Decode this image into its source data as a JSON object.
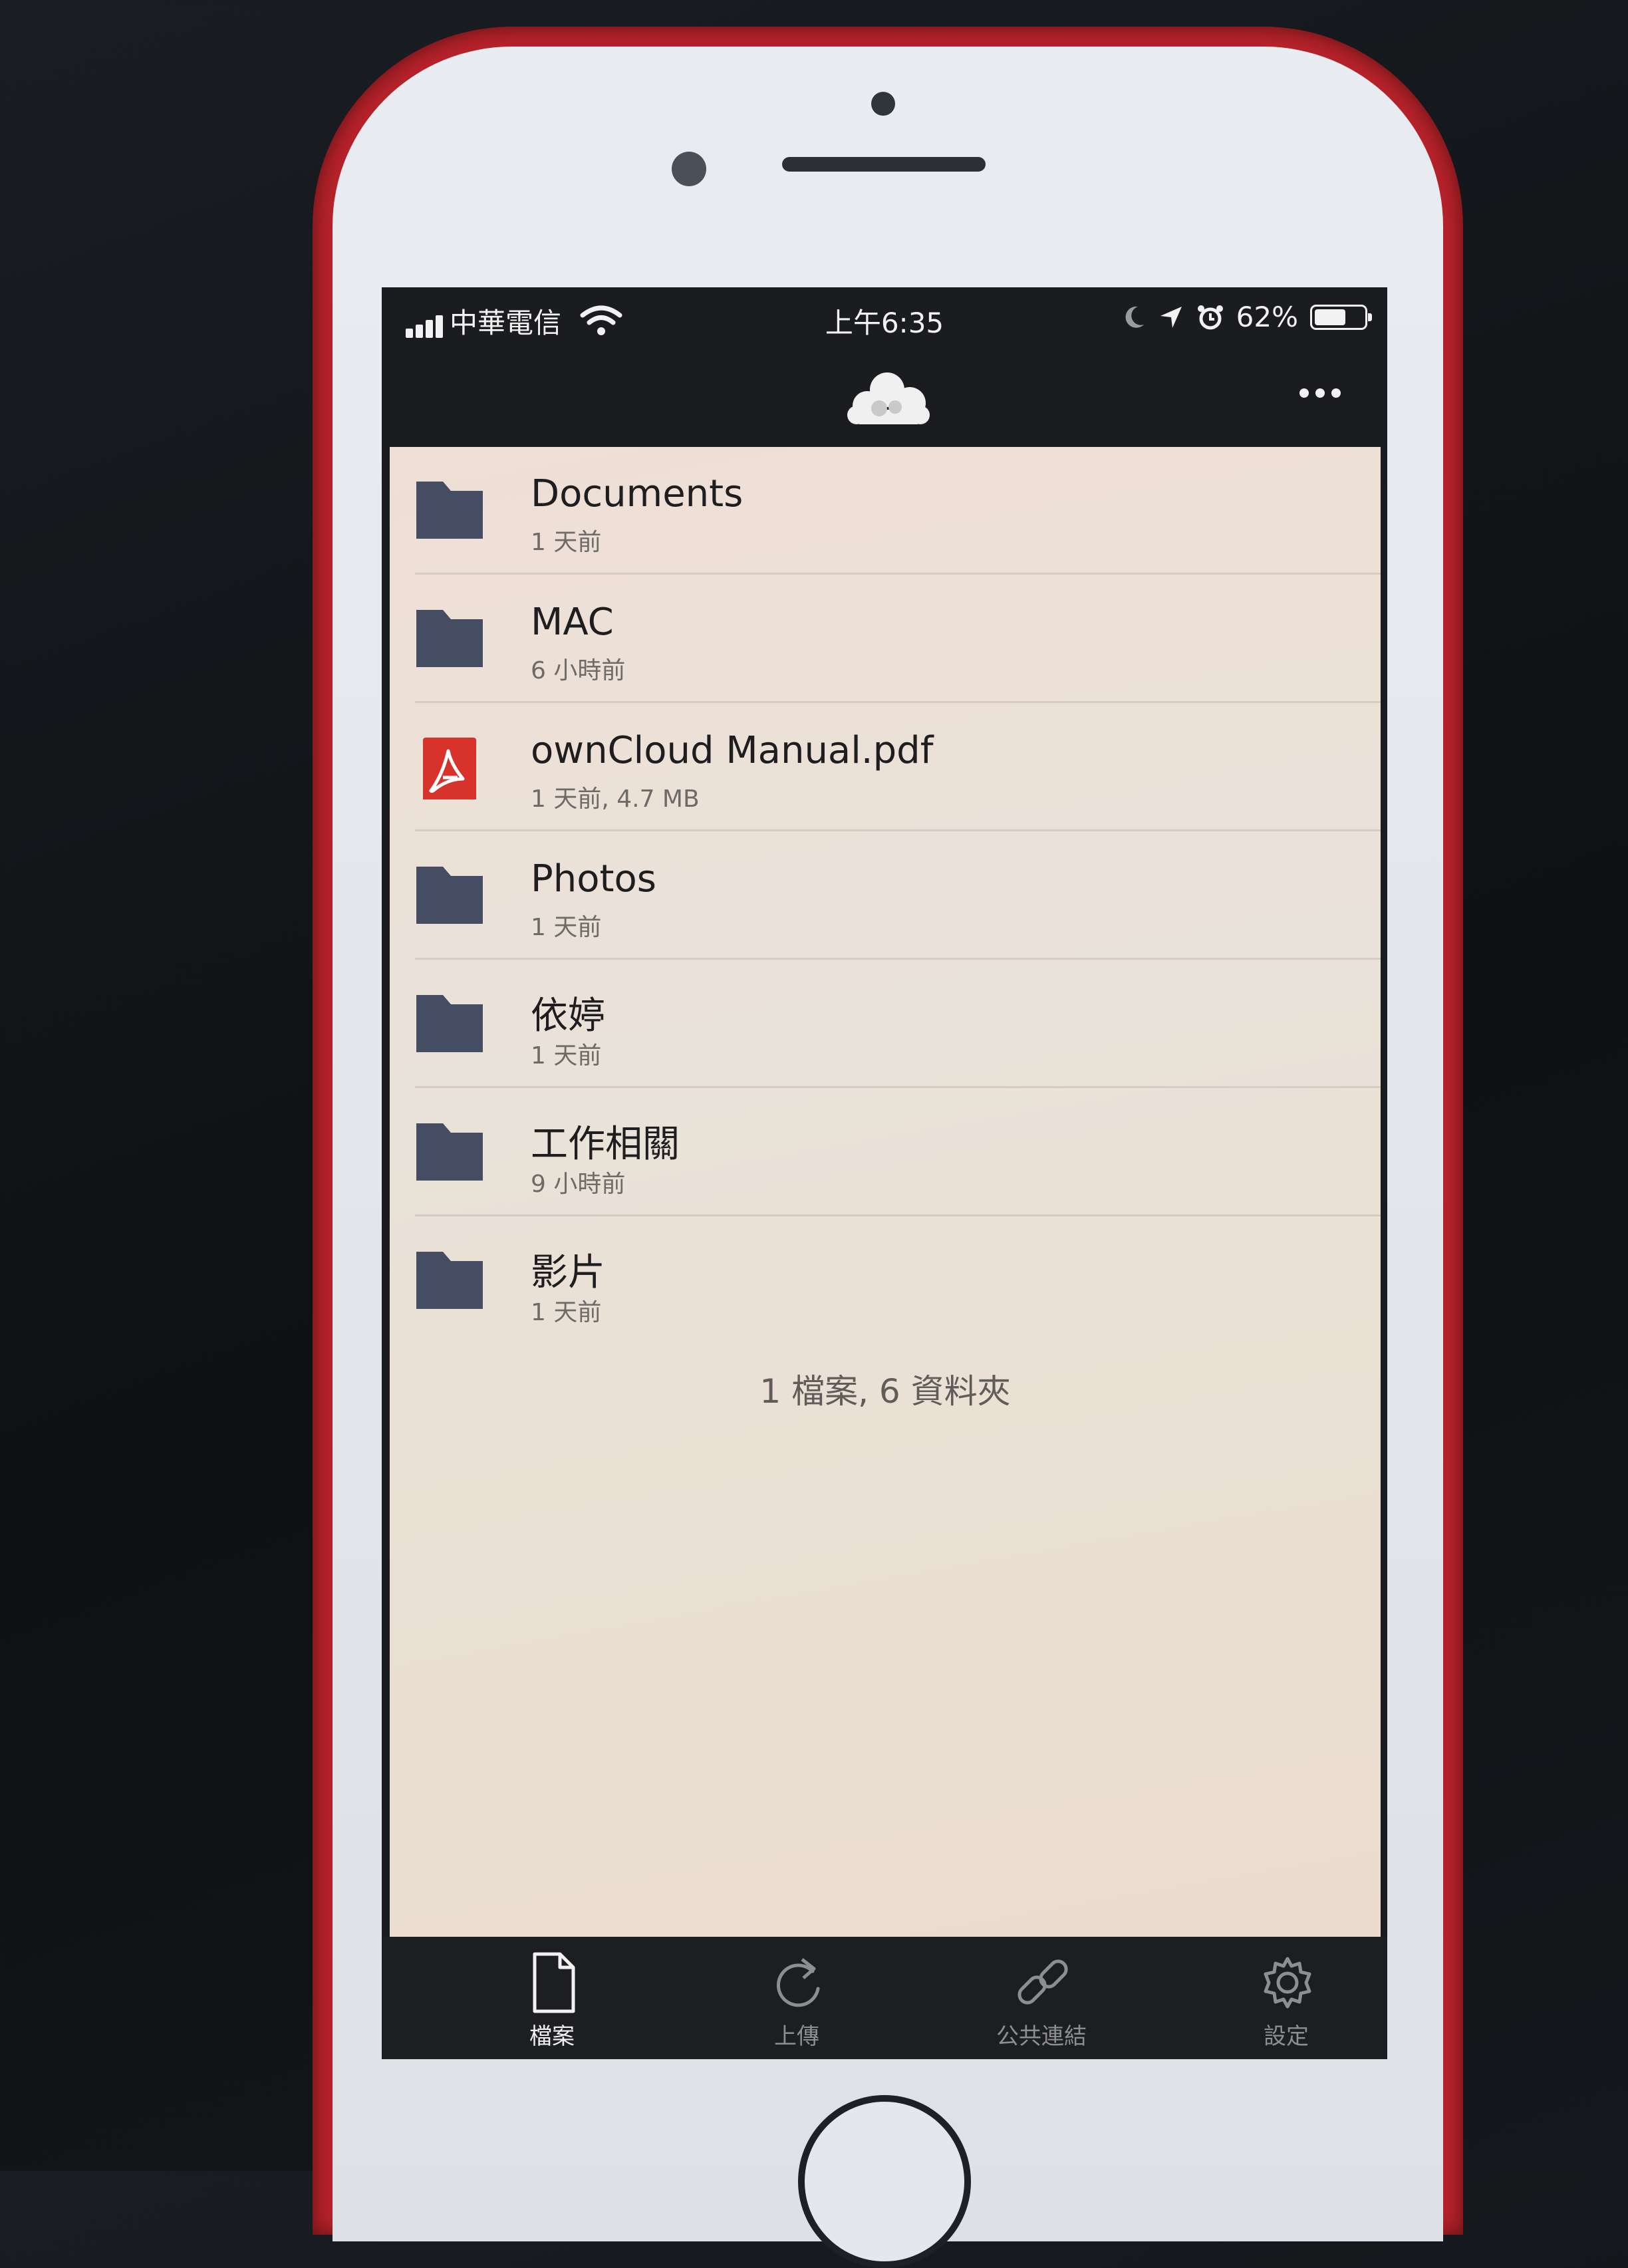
{
  "status_bar": {
    "carrier": "中華電信",
    "time": "上午6:35",
    "battery": "62%",
    "battery_level": 0.62,
    "icons": [
      "signal-icon",
      "wifi-icon",
      "moon-icon",
      "location-icon",
      "alarm-icon",
      "battery-icon"
    ]
  },
  "nav_bar": {
    "logo_icon": "owncloud-logo-icon",
    "more_icon": "more-dots-icon"
  },
  "files": [
    {
      "name": "Documents",
      "meta": "1 天前",
      "icon": "folder-icon"
    },
    {
      "name": "MAC",
      "meta": "6 小時前",
      "icon": "folder-icon"
    },
    {
      "name": "ownCloud Manual.pdf",
      "meta": "1 天前, 4.7 MB",
      "icon": "pdf-icon"
    },
    {
      "name": "Photos",
      "meta": "1 天前",
      "icon": "folder-icon"
    },
    {
      "name": "依婷",
      "meta": "1 天前",
      "icon": "folder-icon"
    },
    {
      "name": "工作相關",
      "meta": "9 小時前",
      "icon": "folder-icon"
    },
    {
      "name": "影片",
      "meta": "1 天前",
      "icon": "folder-icon"
    }
  ],
  "summary": "1 檔案, 6 資料夾",
  "tabs": [
    {
      "label": "檔案",
      "icon": "file-icon",
      "active": true
    },
    {
      "label": "上傳",
      "icon": "refresh-icon",
      "active": false
    },
    {
      "label": "公共連結",
      "icon": "link-icon",
      "active": false
    },
    {
      "label": "設定",
      "icon": "gear-icon",
      "active": false
    }
  ],
  "colors": {
    "folder": "#454d63",
    "pdf": "#d8332b",
    "list_background": "#ebdfd5",
    "bar_background": "#1b1c1f",
    "phone_frame": "#b7222a"
  }
}
